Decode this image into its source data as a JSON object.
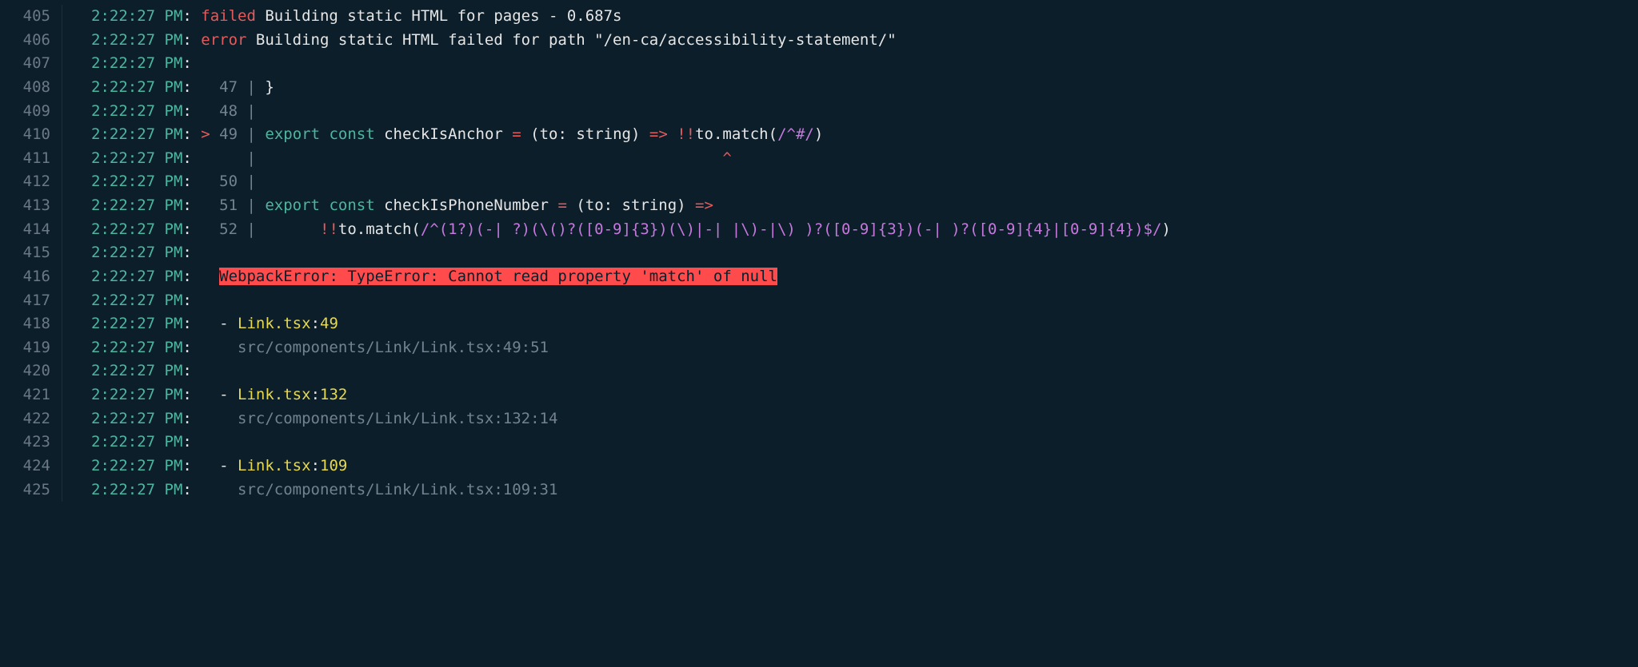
{
  "lines": [
    {
      "num": "405",
      "ts": "2:22:27 PM",
      "segs": [
        {
          "c": "failed",
          "t": "failed"
        },
        {
          "c": "white",
          "t": " Building static HTML for pages - 0.687s"
        }
      ]
    },
    {
      "num": "406",
      "ts": "2:22:27 PM",
      "segs": [
        {
          "c": "error",
          "t": "error"
        },
        {
          "c": "white",
          "t": " Building static HTML failed for path \"/en-ca/accessibility-statement/\""
        }
      ]
    },
    {
      "num": "407",
      "ts": "2:22:27 PM",
      "segs": []
    },
    {
      "num": "408",
      "ts": "2:22:27 PM",
      "segs": [
        {
          "c": "dim",
          "t": "  47 | "
        },
        {
          "c": "white",
          "t": "}"
        }
      ]
    },
    {
      "num": "409",
      "ts": "2:22:27 PM",
      "segs": [
        {
          "c": "dim",
          "t": "  48 |"
        }
      ]
    },
    {
      "num": "410",
      "ts": "2:22:27 PM",
      "segs": [
        {
          "c": "pointer",
          "t": ">"
        },
        {
          "c": "dim",
          "t": " 49 | "
        },
        {
          "c": "kw-export",
          "t": "export"
        },
        {
          "c": "white",
          "t": " "
        },
        {
          "c": "kw-const",
          "t": "const"
        },
        {
          "c": "white",
          "t": " checkIsAnchor "
        },
        {
          "c": "op-eq",
          "t": "="
        },
        {
          "c": "white",
          "t": " (to: string) "
        },
        {
          "c": "arrow",
          "t": "=>"
        },
        {
          "c": "white",
          "t": " "
        },
        {
          "c": "bang",
          "t": "!!"
        },
        {
          "c": "white",
          "t": "to.match("
        },
        {
          "c": "regex",
          "t": "/^#/"
        },
        {
          "c": "white",
          "t": ")"
        }
      ]
    },
    {
      "num": "411",
      "ts": "2:22:27 PM",
      "segs": [
        {
          "c": "dim",
          "t": "     |                                                   "
        },
        {
          "c": "caret",
          "t": "^"
        }
      ]
    },
    {
      "num": "412",
      "ts": "2:22:27 PM",
      "segs": [
        {
          "c": "dim",
          "t": "  50 |"
        }
      ]
    },
    {
      "num": "413",
      "ts": "2:22:27 PM",
      "segs": [
        {
          "c": "dim",
          "t": "  51 | "
        },
        {
          "c": "kw-export",
          "t": "export"
        },
        {
          "c": "white",
          "t": " "
        },
        {
          "c": "kw-const",
          "t": "const"
        },
        {
          "c": "white",
          "t": " checkIsPhoneNumber "
        },
        {
          "c": "op-eq",
          "t": "="
        },
        {
          "c": "white",
          "t": " (to: string) "
        },
        {
          "c": "arrow",
          "t": "=>"
        }
      ]
    },
    {
      "num": "414",
      "ts": "2:22:27 PM",
      "segs": [
        {
          "c": "dim",
          "t": "  52 | "
        },
        {
          "c": "white",
          "t": "      "
        },
        {
          "c": "bang",
          "t": "!!"
        },
        {
          "c": "white",
          "t": "to.match("
        },
        {
          "c": "regex",
          "t": "/^(1?)(-| ?)(\\()?([0-9]{3})(\\)|-| |\\)-|\\) )?([0-9]{3})(-| )?([0-9]{4}|[0-9]{4})$/"
        },
        {
          "c": "white",
          "t": ")"
        }
      ]
    },
    {
      "num": "415",
      "ts": "2:22:27 PM",
      "segs": []
    },
    {
      "num": "416",
      "ts": "2:22:27 PM",
      "segs": [
        {
          "c": "white",
          "t": "  "
        },
        {
          "c": "err-hl",
          "t": "WebpackError: TypeError: Cannot read property 'match' of null"
        }
      ]
    },
    {
      "num": "417",
      "ts": "2:22:27 PM",
      "segs": []
    },
    {
      "num": "418",
      "ts": "2:22:27 PM",
      "segs": [
        {
          "c": "white",
          "t": "  - "
        },
        {
          "c": "file-y",
          "t": "Link.tsx"
        },
        {
          "c": "white",
          "t": ":"
        },
        {
          "c": "num-y",
          "t": "49"
        }
      ]
    },
    {
      "num": "419",
      "ts": "2:22:27 PM",
      "segs": [
        {
          "c": "path-dim",
          "t": "    src/components/Link/Link.tsx:49:51"
        }
      ]
    },
    {
      "num": "420",
      "ts": "2:22:27 PM",
      "segs": []
    },
    {
      "num": "421",
      "ts": "2:22:27 PM",
      "segs": [
        {
          "c": "white",
          "t": "  - "
        },
        {
          "c": "file-y",
          "t": "Link.tsx"
        },
        {
          "c": "white",
          "t": ":"
        },
        {
          "c": "num-y",
          "t": "132"
        }
      ]
    },
    {
      "num": "422",
      "ts": "2:22:27 PM",
      "segs": [
        {
          "c": "path-dim",
          "t": "    src/components/Link/Link.tsx:132:14"
        }
      ]
    },
    {
      "num": "423",
      "ts": "2:22:27 PM",
      "segs": []
    },
    {
      "num": "424",
      "ts": "2:22:27 PM",
      "segs": [
        {
          "c": "white",
          "t": "  - "
        },
        {
          "c": "file-y",
          "t": "Link.tsx"
        },
        {
          "c": "white",
          "t": ":"
        },
        {
          "c": "num-y",
          "t": "109"
        }
      ]
    },
    {
      "num": "425",
      "ts": "2:22:27 PM",
      "segs": [
        {
          "c": "path-dim",
          "t": "    src/components/Link/Link.tsx:109:31"
        }
      ]
    }
  ]
}
